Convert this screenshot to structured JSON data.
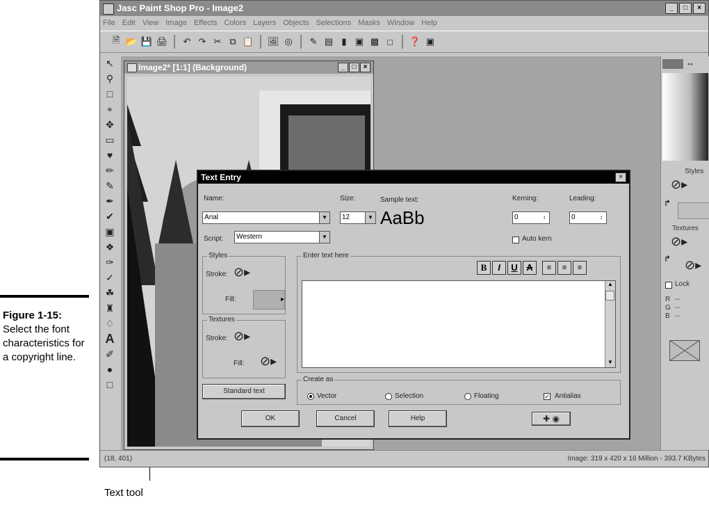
{
  "caption": {
    "figure": "Figure 1-15:",
    "text": "Select the font characteristics for a copyright line."
  },
  "callout": {
    "label": "Text tool"
  },
  "app": {
    "title": "Jasc Paint Shop Pro - Image2",
    "window_buttons": [
      "_",
      "×"
    ],
    "menu": [
      "File",
      "Edit",
      "View",
      "Image",
      "Effects",
      "Colors",
      "Layers",
      "Objects",
      "Selections",
      "Masks",
      "Window",
      "Help"
    ],
    "status_left": "(18, 401)",
    "status_right": "Image:  319 x 420 x 16 Million - 393.7 KBytes"
  },
  "image_window": {
    "title": "Image2* [1:1] (Background)"
  },
  "right_panel": {
    "styles": "Styles",
    "textures": "Textures",
    "lock": "Lock",
    "r": "R",
    "g": "G",
    "b": "B",
    "dash": "--"
  },
  "dialog": {
    "title": "Text Entry",
    "close": "×",
    "name_label": "Name:",
    "name_value": "Arial",
    "size_label": "Size:",
    "size_value": "12",
    "sample_label": "Sample text:",
    "sample_text": "AaBb",
    "kerning_label": "Kerning:",
    "kerning_value": "0",
    "leading_label": "Leading:",
    "leading_value": "0",
    "script_label": "Script:",
    "script_value": "Western",
    "autokern_label": "Auto kern",
    "styles_group": "Styles",
    "stroke_label": "Stroke:",
    "fill_label": "Fill:",
    "textures_group": "Textures",
    "enter_text_group": "Enter text here",
    "format_buttons": [
      "B",
      "I",
      "U",
      "A"
    ],
    "standard_text_btn": "Standard text",
    "create_as_group": "Create as",
    "options": [
      "Vector",
      "Selection",
      "Floating"
    ],
    "antialias_label": "Antialias",
    "ok": "OK",
    "cancel": "Cancel",
    "help": "Help",
    "selected_option": "Vector",
    "antialias_checked": true
  }
}
